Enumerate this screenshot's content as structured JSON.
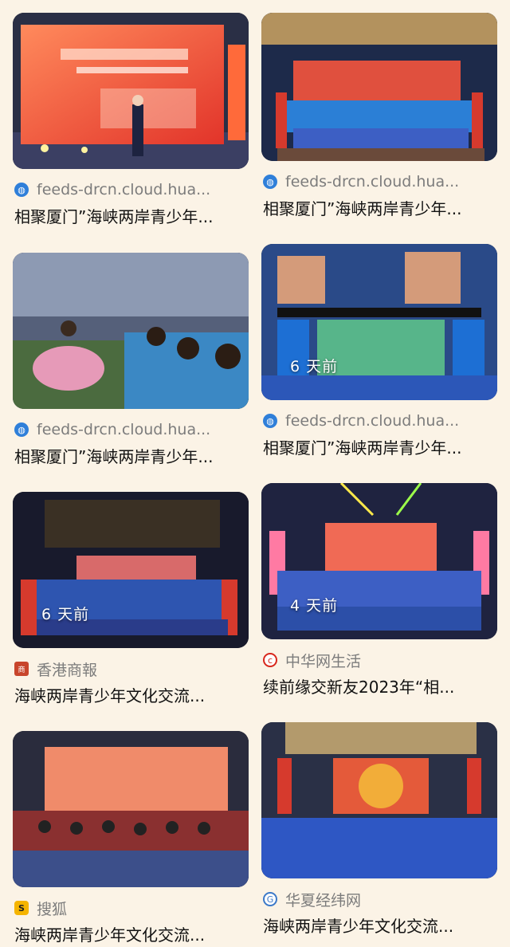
{
  "colors": {
    "background": "#fbf3e6",
    "source_text": "#7c7c7c",
    "title_text": "#111111"
  },
  "cards": [
    {
      "source": "feeds-drcn.cloud.hua...",
      "source_icon": "globe-icon",
      "title": "相聚厦门”海峡两岸青少年...",
      "age": ""
    },
    {
      "source": "feeds-drcn.cloud.hua...",
      "source_icon": "globe-icon",
      "title": "相聚厦门”海峡两岸青少年...",
      "age": ""
    },
    {
      "source": "feeds-drcn.cloud.hua...",
      "source_icon": "globe-icon",
      "title": "相聚厦门”海峡两岸青少年...",
      "age": ""
    },
    {
      "source": "feeds-drcn.cloud.hua...",
      "source_icon": "globe-icon",
      "title": "相聚厦门”海峡两岸青少年...",
      "age": "6 天前"
    },
    {
      "source": "香港商報",
      "source_icon": "hk-commercial-daily-logo-icon",
      "title": "海峡两岸青少年文化交流...",
      "age": "6 天前"
    },
    {
      "source": "中华网生活",
      "source_icon": "china-com-logo-icon",
      "title": "续前缘交新友2023年“相...",
      "age": "4 天前"
    },
    {
      "source": "搜狐",
      "source_icon": "sohu-logo-icon",
      "title": "海峡两岸青少年文化交流...",
      "age": ""
    },
    {
      "source": "华夏经纬网",
      "source_icon": "huaxia-logo-icon",
      "title": "海峡两岸青少年文化交流...",
      "age": ""
    }
  ]
}
